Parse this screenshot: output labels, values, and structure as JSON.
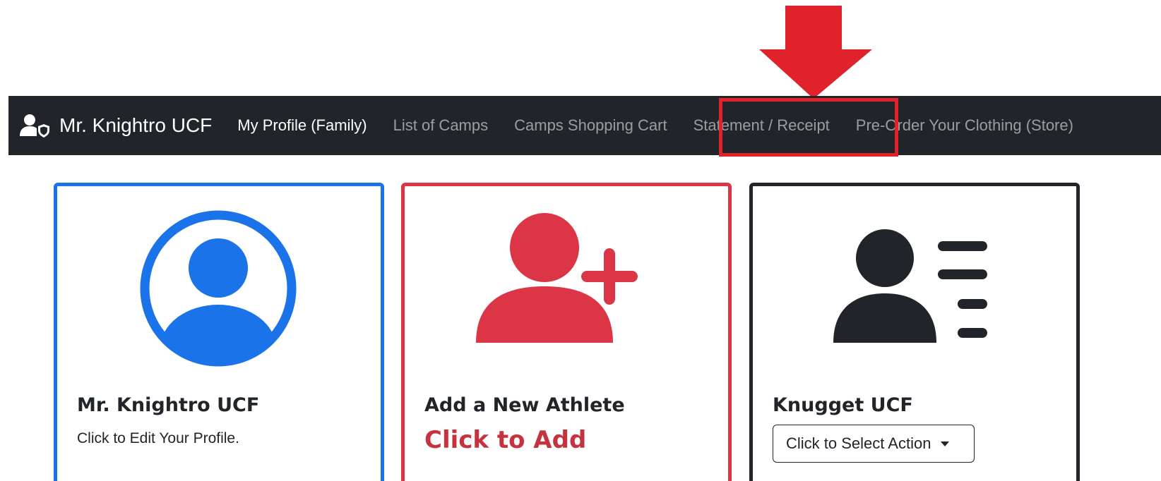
{
  "navbar": {
    "brand": "Mr. Knightro UCF",
    "links": [
      {
        "label": "My Profile (Family)",
        "active": true
      },
      {
        "label": "List of Camps",
        "active": false
      },
      {
        "label": "Camps Shopping Cart",
        "active": false
      },
      {
        "label": "Statement / Receipt",
        "active": false,
        "highlighted": true
      },
      {
        "label": "Pre-Order Your Clothing (Store)",
        "active": false
      }
    ]
  },
  "cards": {
    "profile": {
      "title": "Mr. Knightro UCF",
      "subtitle": "Click to Edit Your Profile.",
      "icon": "user-circle-icon"
    },
    "add_athlete": {
      "title": "Add a New Athlete",
      "action": "Click to Add",
      "icon": "user-plus-icon"
    },
    "athlete": {
      "title": "Knugget UCF",
      "dropdown_label": "Click to Select Action",
      "icon": "user-list-icon"
    }
  },
  "annotation": {
    "arrow": "down-arrow-icon",
    "target": "Statement / Receipt"
  },
  "colors": {
    "navbar_bg": "#212529",
    "profile_blue": "#1a73e8",
    "add_red": "#dc3545",
    "annotation_red": "#e0222a"
  }
}
